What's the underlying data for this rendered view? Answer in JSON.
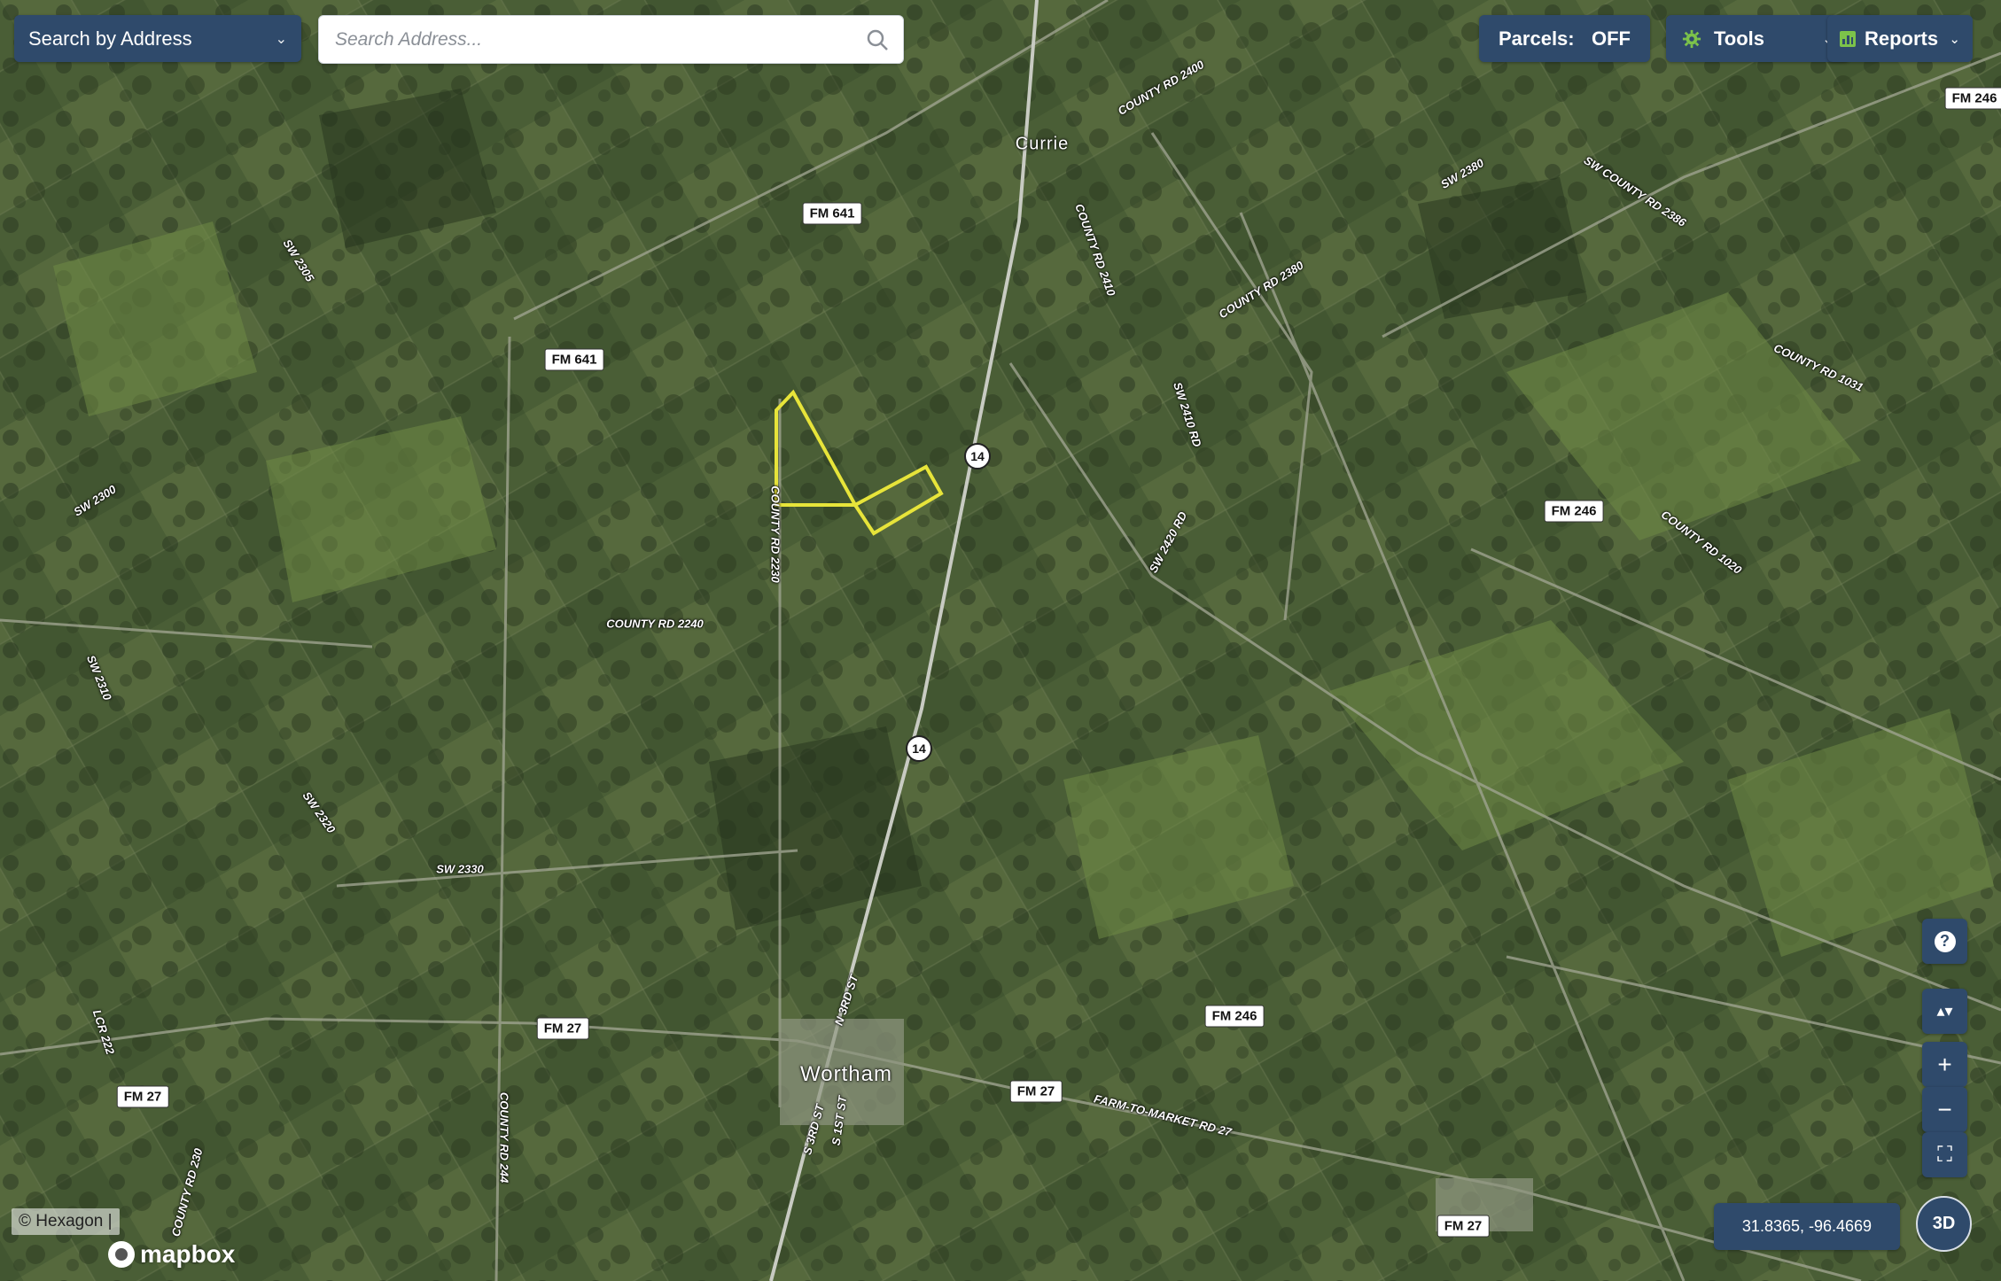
{
  "header": {
    "search_mode_label": "Search by Address",
    "search_placeholder": "Search Address...",
    "parcels_label": "Parcels:",
    "parcels_value": "OFF",
    "tools_label": "Tools",
    "reports_label": "Reports"
  },
  "map_controls": {
    "help_label": "?",
    "compass_label": "▴▾",
    "zoom_in_label": "+",
    "zoom_out_label": "−",
    "fullscreen_label": "⛶",
    "three_d_label": "3D",
    "coords_label": "31.8365, -96.4669"
  },
  "attribution": {
    "text": "© Hexagon |",
    "logo_text": "mapbox"
  },
  "icons": {
    "search": "search-icon",
    "tools": "gear-icon",
    "reports": "bar-chart-icon",
    "dropdown": "chevron-down-icon"
  },
  "colors": {
    "navy": "#2f4a6b",
    "parcel_outline": "#e7e43a",
    "road_label_fill": "#ffffff"
  },
  "map_labels": {
    "place_currie": "Currie",
    "place_wortham": "Wortham",
    "fm641_a": "FM 641",
    "fm641_b": "FM 641",
    "fm246_a": "FM 246",
    "fm246_b": "FM 246",
    "fm246_c": "FM 246",
    "fm27_a": "FM 27",
    "fm27_b": "FM 27",
    "fm27_c": "FM 27",
    "fm27_d": "FM 27",
    "hwy14_a": "14",
    "hwy14_b": "14",
    "cr2400": "COUNTY RD 2400",
    "cr2410": "COUNTY RD 2410",
    "cr2380": "COUNTY RD 2380",
    "sw2380": "SW 2380",
    "swcr2386": "SW COUNTY RD 2386",
    "cr1031": "COUNTY RD 1031",
    "cr1020": "COUNTY RD 1020",
    "sw2410": "SW 2410 RD",
    "sw2420": "SW 2420 RD",
    "sw2305": "SW 2305",
    "sw2300": "SW 2300",
    "sw2310": "SW 2310",
    "sw2320": "SW 2320",
    "sw2330": "SW 2330",
    "cr2230": "COUNTY RD 2230",
    "cr2240": "COUNTY RD 2240",
    "n3rd": "N 3RD ST",
    "s3rd": "S 3RD ST",
    "s1st": "S 1ST ST",
    "fm27_road": "FARM-TO-MARKET RD 27",
    "lcr222": "LCR 222",
    "cr230": "COUNTY RD 230",
    "cr244": "COUNTY RD 244"
  }
}
